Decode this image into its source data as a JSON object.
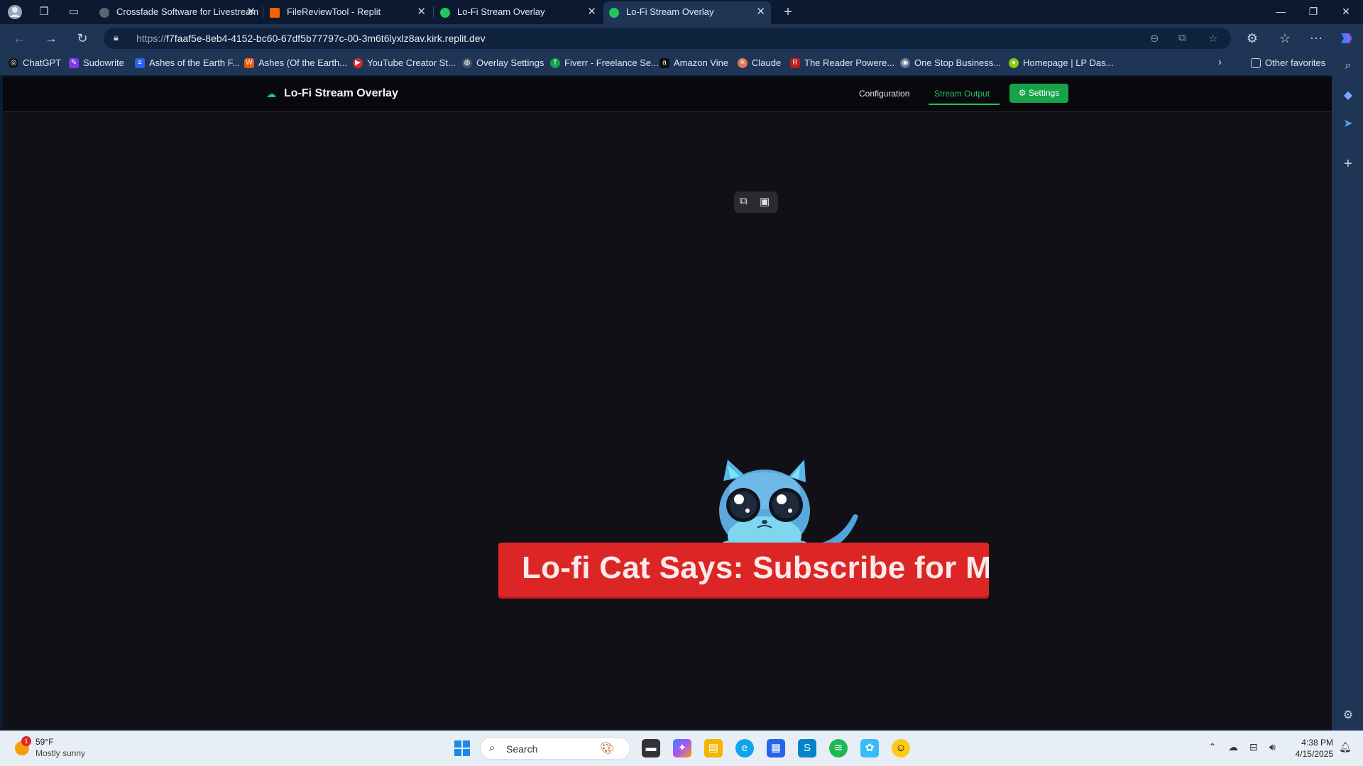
{
  "browser": {
    "tabs": [
      {
        "label": "Crossfade Software for Livestream",
        "favicon_color": "#5c6470"
      },
      {
        "label": "FileReviewTool - Replit",
        "favicon_color": "#f26207"
      },
      {
        "label": "Lo-Fi Stream Overlay",
        "favicon_color": "#22c55e"
      },
      {
        "label": "Lo-Fi Stream Overlay",
        "favicon_color": "#22c55e",
        "active": true
      }
    ],
    "url_prefix": "https://",
    "url_host": "f7faaf5e-8eb4-4152-bc60-67df5b77797c-00-3m6t6lyxlz8av.kirk.replit.dev",
    "bookmarks": [
      {
        "label": "ChatGPT",
        "icon": "chatgpt-icon",
        "color": "#000000"
      },
      {
        "label": "Sudowrite",
        "icon": "sudowrite-icon",
        "color": "#7c3aed"
      },
      {
        "label": "Ashes of the Earth F...",
        "icon": "doc-icon",
        "color": "#2563eb"
      },
      {
        "label": "Ashes (Of the Earth...",
        "icon": "w-icon",
        "color": "#ea580c"
      },
      {
        "label": "YouTube Creator St...",
        "icon": "youtube-icon",
        "color": "#dc2626"
      },
      {
        "label": "Overlay Settings",
        "icon": "globe-icon",
        "color": "#475569"
      },
      {
        "label": "Fiverr - Freelance Se...",
        "icon": "fiverr-icon",
        "color": "#16a34a"
      },
      {
        "label": "Amazon Vine",
        "icon": "amazon-icon",
        "color": "#111111"
      },
      {
        "label": "Claude",
        "icon": "claude-icon",
        "color": "#d97757"
      },
      {
        "label": "The Reader Powere...",
        "icon": "reader-icon",
        "color": "#b91c1c"
      },
      {
        "label": "One Stop Business...",
        "icon": "business-icon",
        "color": "#64748b"
      },
      {
        "label": "Homepage | LP Das...",
        "icon": "lp-icon",
        "color": "#84cc16"
      }
    ],
    "other_favorites": "Other favorites"
  },
  "app": {
    "brand": "Lo-Fi Stream Overlay",
    "nav": {
      "configuration": "Configuration",
      "stream_output": "Stream Output",
      "settings": "⚙ Settings"
    },
    "accent": "#22c55e",
    "banner_text": "Lo-fi Cat Says: Subscribe for Mor",
    "banner_color": "#dc2626"
  },
  "taskbar": {
    "weather_temp": "59°F",
    "weather_desc": "Mostly sunny",
    "weather_badge": "1",
    "search_placeholder": "Search",
    "time": "4:38 PM",
    "date": "4/15/2025"
  }
}
